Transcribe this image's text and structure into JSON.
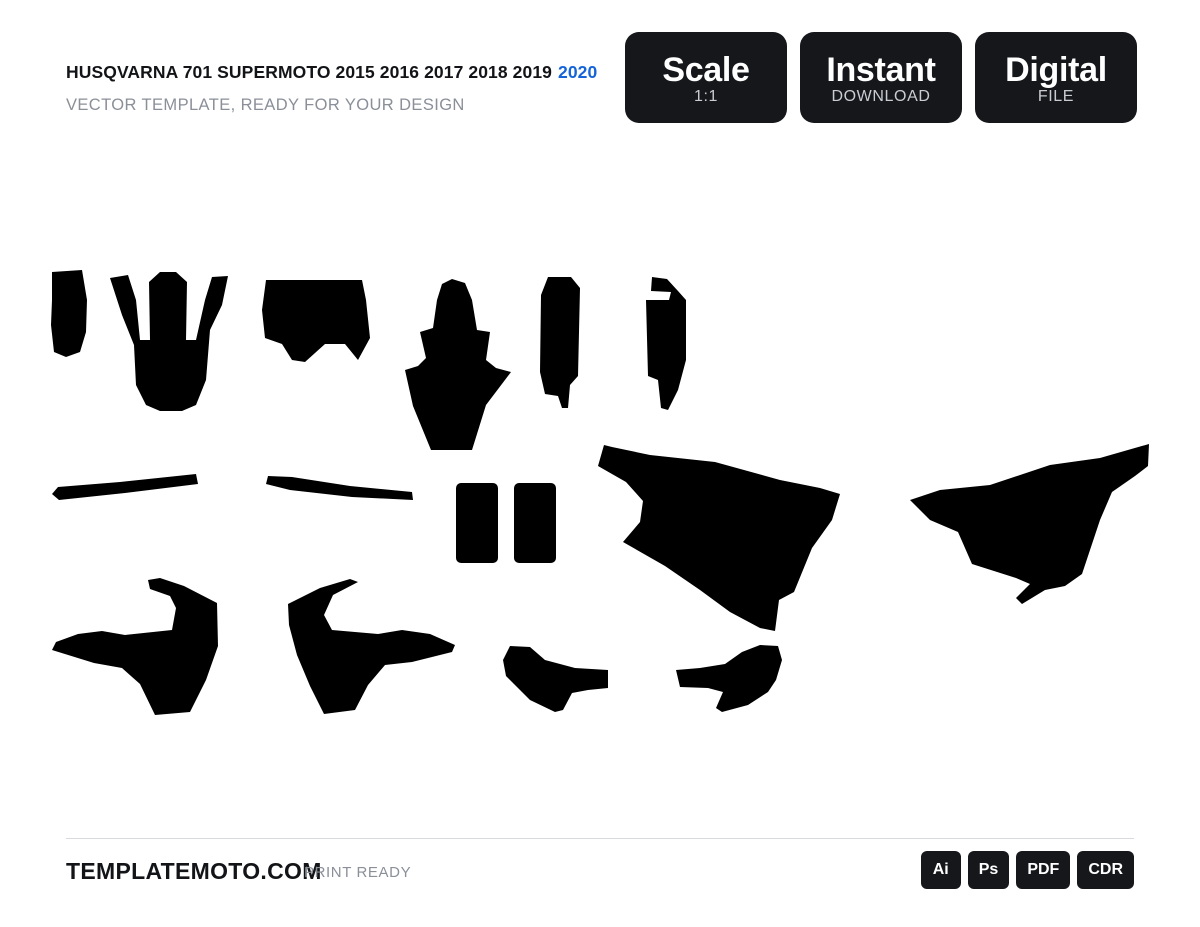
{
  "header": {
    "title": "HUSQVARNA 701 SUPERMOTO 2015 2016 2017 2018 2019",
    "title_highlight": "2020",
    "subtitle": "VECTOR TEMPLATE, READY FOR YOUR DESIGN",
    "highlight_color": "#1565d8"
  },
  "badges": [
    {
      "big": "Scale",
      "small": "1:1"
    },
    {
      "big": "Instant",
      "small": "DOWNLOAD"
    },
    {
      "big": "Digital",
      "small": "FILE"
    }
  ],
  "footer": {
    "brand": "TEMPLATEMOTO.COM",
    "note": "PRINT READY",
    "formats": [
      "Ai",
      "Ps",
      "PDF",
      "CDR"
    ]
  },
  "template": {
    "fill_color": "#000000"
  }
}
